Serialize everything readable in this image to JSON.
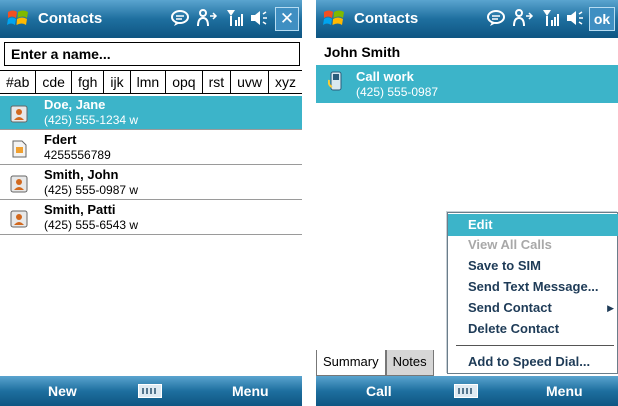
{
  "left": {
    "title": "Contacts",
    "close_label": "✕",
    "name_placeholder": "Enter a name...",
    "alpha_tabs": [
      "#ab",
      "cde",
      "fgh",
      "ijk",
      "lmn",
      "opq",
      "rst",
      "uvw",
      "xyz"
    ],
    "contacts": [
      {
        "name": "Doe, Jane",
        "number": "(425) 555-1234  w",
        "selected": true
      },
      {
        "name": "Fdert",
        "number": "4255556789",
        "selected": false
      },
      {
        "name": "Smith, John",
        "number": "(425) 555-0987  w",
        "selected": false
      },
      {
        "name": "Smith, Patti",
        "number": "(425) 555-6543  w",
        "selected": false
      }
    ],
    "softkeys": {
      "left": "New",
      "right": "Menu"
    }
  },
  "right": {
    "title": "Contacts",
    "ok_label": "ok",
    "contact_name": "John Smith",
    "action": {
      "label": "Call work",
      "number": "(425) 555-0987"
    },
    "tabs": [
      "Summary",
      "Notes"
    ],
    "menu": [
      {
        "label": "Edit",
        "selected": true,
        "disabled": false
      },
      {
        "label": "View All Calls",
        "selected": false,
        "disabled": true
      },
      {
        "label": "Save to SIM",
        "selected": false,
        "disabled": false
      },
      {
        "label": "Send Text Message...",
        "selected": false,
        "disabled": false
      },
      {
        "label": "Send Contact",
        "selected": false,
        "disabled": false,
        "submenu": true
      },
      {
        "label": "Delete Contact",
        "selected": false,
        "disabled": false
      },
      {
        "label": "Add to Speed Dial...",
        "selected": false,
        "disabled": false
      }
    ],
    "softkeys": {
      "left": "Call",
      "right": "Menu"
    }
  },
  "status_icons": [
    "messaging-icon",
    "connectivity-icon",
    "signal-icon",
    "speaker-icon"
  ],
  "colors": {
    "titlebar": "#1e6f9f",
    "selection": "#3cb4c9"
  }
}
